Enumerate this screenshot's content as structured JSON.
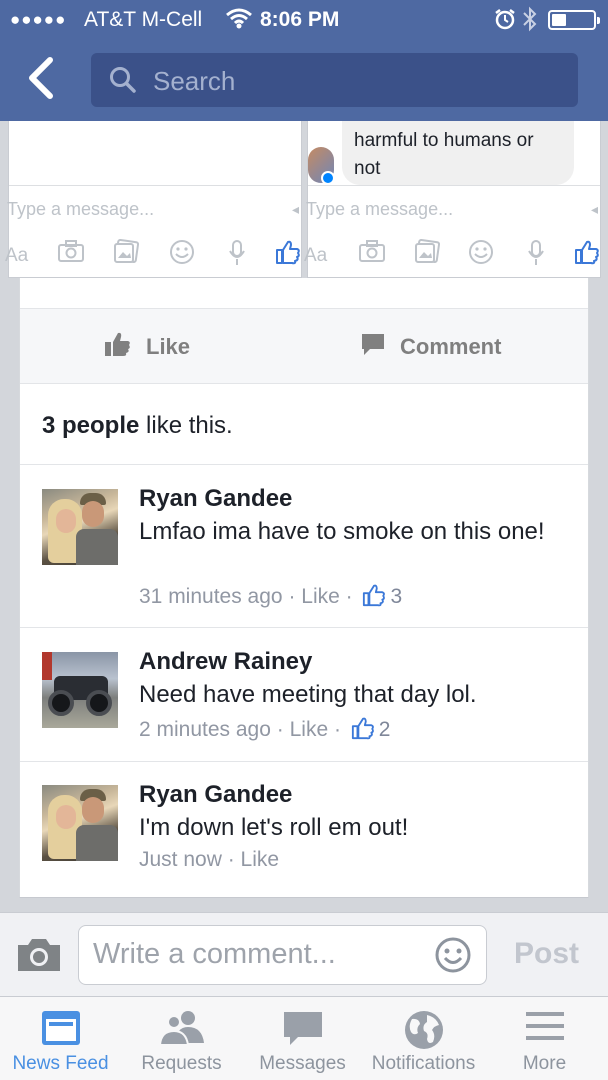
{
  "status_bar": {
    "signal": "●●●●●",
    "carrier": "AT&T M-Cell",
    "time": "8:06 PM"
  },
  "nav": {
    "back_icon": "chevron-left-icon",
    "search_placeholder": "Search"
  },
  "chat_heads": [
    {
      "message_placeholder": "Type a message...",
      "aa_label": "Aa"
    },
    {
      "last_message": "harmful to humans or not",
      "message_placeholder": "Type a message...",
      "aa_label": "Aa"
    }
  ],
  "post": {
    "actions": {
      "like": "Like",
      "comment": "Comment"
    },
    "likes_count_text": "3 people",
    "likes_suffix": " like this."
  },
  "comments": [
    {
      "author": "Ryan Gandee",
      "text": "Lmfao ima have to smoke on this one!",
      "time": "31 minutes ago",
      "like_label": "Like",
      "like_count": "3"
    },
    {
      "author": "Andrew Rainey",
      "text": "Need have meeting that day lol.",
      "time": "2 minutes ago",
      "like_label": "Like",
      "like_count": "2"
    },
    {
      "author": "Ryan Gandee",
      "text": "I'm down let's roll em out!",
      "time": "Just now",
      "like_label": "Like"
    }
  ],
  "composer": {
    "placeholder": "Write a comment...",
    "post_label": "Post"
  },
  "tabbar": {
    "items": [
      {
        "label": "News Feed",
        "icon": "news-feed-icon",
        "active": true
      },
      {
        "label": "Requests",
        "icon": "friend-requests-icon"
      },
      {
        "label": "Messages",
        "icon": "messages-icon"
      },
      {
        "label": "Notifications",
        "icon": "globe-icon"
      },
      {
        "label": "More",
        "icon": "menu-icon"
      }
    ]
  },
  "colors": {
    "header": "#4e69a2",
    "search_bg": "#3b5189",
    "active_tab": "#4a90e2",
    "link_blue": "#3b78d8"
  }
}
